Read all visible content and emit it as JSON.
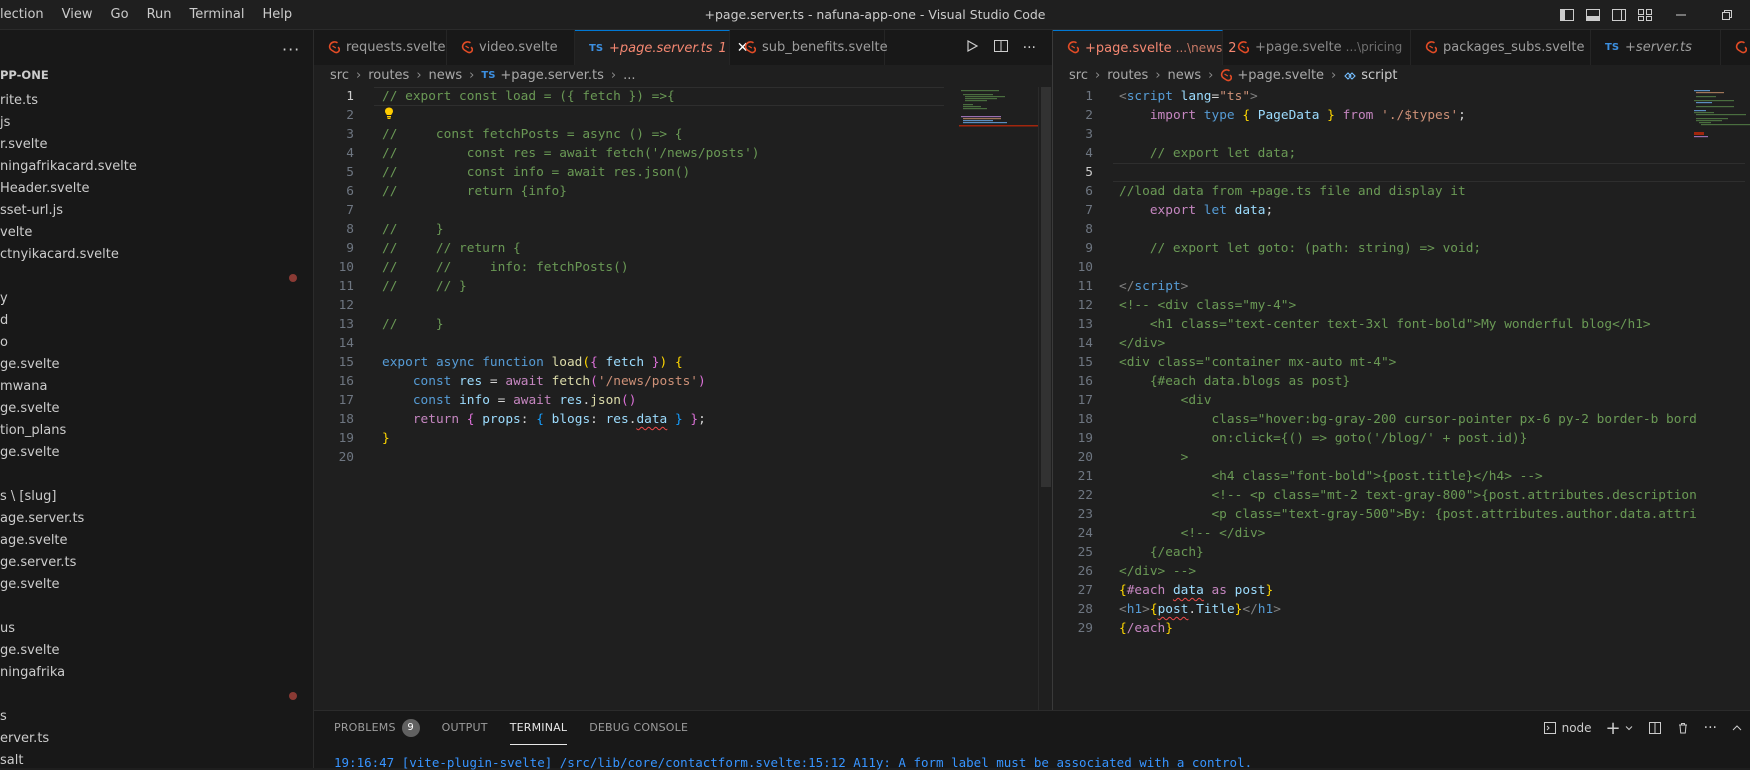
{
  "window": {
    "title": "+page.server.ts - nafuna-app-one - Visual Studio Code",
    "menu": [
      "lection",
      "View",
      "Go",
      "Run",
      "Terminal",
      "Help"
    ]
  },
  "sidebar": {
    "more_label": "···",
    "project_label": "PP-ONE",
    "items": [
      "rite.ts",
      "js",
      "r.svelte",
      "ningafrikacard.svelte",
      "Header.svelte",
      "sset-url.js",
      "velte",
      "ctnyikacard.svelte",
      "",
      "y",
      "d",
      "o",
      "ge.svelte",
      "mwana",
      "ge.svelte",
      "tion_plans",
      "ge.svelte",
      "",
      "s \\ [slug]",
      "age.server.ts",
      "age.svelte",
      "ge.server.ts",
      "ge.svelte",
      "",
      "us",
      "ge.svelte",
      "ningafrika",
      "",
      "s",
      "erver.ts",
      "salt"
    ]
  },
  "left_editor": {
    "tabs": [
      {
        "label": "requests.svelte",
        "icon": "svelte-icon",
        "active": false
      },
      {
        "label": "video.svelte",
        "icon": "svelte-icon",
        "active": false
      },
      {
        "label": "+page.server.ts",
        "icon": "typescript-icon",
        "badge": "1",
        "active": true,
        "modified": true
      },
      {
        "label": "sub_benefits.svelte",
        "icon": "svelte-icon",
        "active": false
      }
    ],
    "ts_icon_text": "TS",
    "breadcrumb": [
      "src",
      "routes",
      "news",
      "+page.server.ts",
      "..."
    ],
    "close_glyph": "✕"
  },
  "right_editor": {
    "tabs": [
      {
        "label": "+page.svelte",
        "desc": "...\\news",
        "badge": "2",
        "icon": "svelte-icon",
        "active": true
      },
      {
        "label": "+page.svelte",
        "desc": "...\\pricing",
        "icon": "svelte-icon",
        "active": false
      },
      {
        "label": "packages_subs.svelte",
        "icon": "svelte-icon",
        "active": false
      },
      {
        "label": "+server.ts",
        "icon": "typescript-icon",
        "active": false
      }
    ],
    "ts_icon_text": "TS",
    "breadcrumb": [
      "src",
      "routes",
      "news",
      "+page.svelte",
      "script"
    ]
  },
  "panel": {
    "tabs": [
      "PROBLEMS",
      "OUTPUT",
      "TERMINAL",
      "DEBUG CONSOLE"
    ],
    "problems_count": "9",
    "active_tab": "TERMINAL",
    "terminal_name": "node",
    "terminal_line": "19:16:47 [vite-plugin-svelte] /src/lib/core/contactform.svelte:15:12 A11y: A form label must be associated with a control."
  },
  "colors": {
    "accent": "#0078d4",
    "svelte": "#e34c26",
    "typescript": "#3c8fe0",
    "modified_dot": "#8a3a34",
    "terminal_text": "#3794ff"
  }
}
